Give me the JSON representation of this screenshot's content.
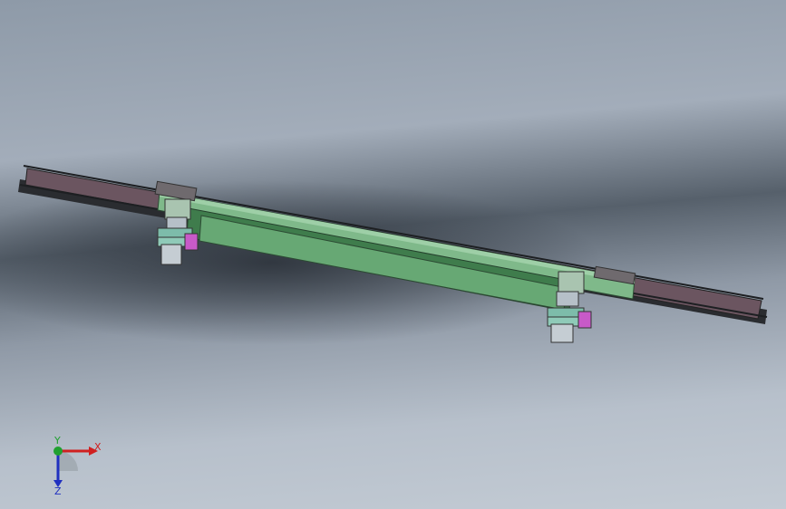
{
  "triad": {
    "x_label": "X",
    "y_label": "Y",
    "z_label": "Z"
  },
  "colors": {
    "rail": "#6b5560",
    "beam": "#67a874",
    "beam_dark": "#3f7c4c",
    "bracket": "#b6c0c8",
    "accent_pink": "#c85ac8",
    "x_axis": "#d02020",
    "y_axis": "#20a030",
    "z_axis": "#2030c0"
  }
}
